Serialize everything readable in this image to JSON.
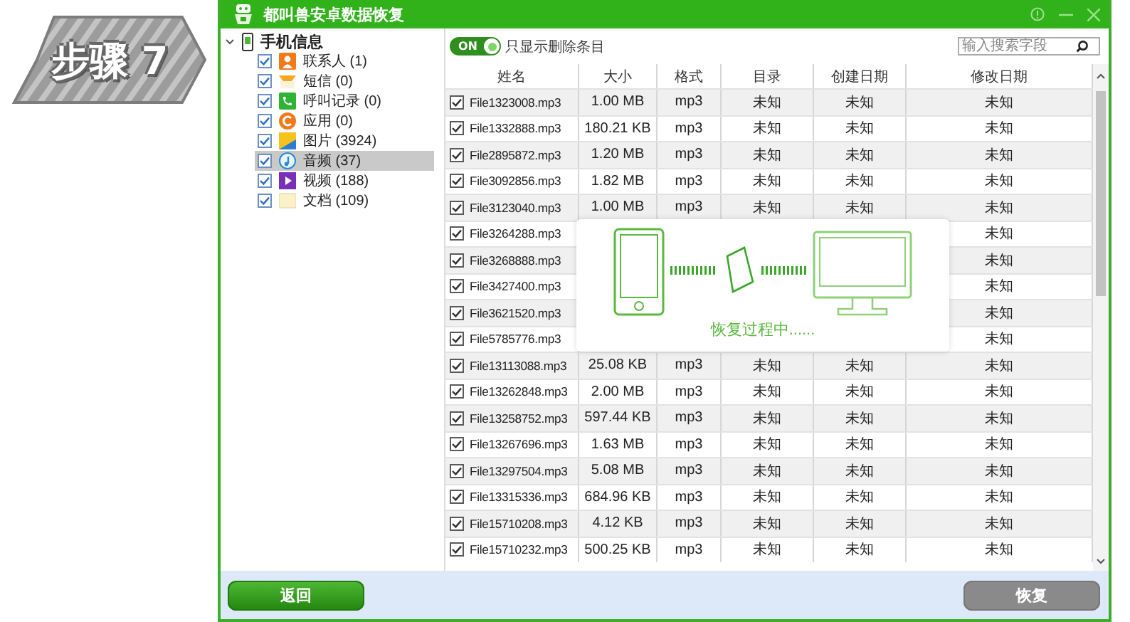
{
  "banner": {
    "text": "步骤 7"
  },
  "window": {
    "title": "都叫兽安卓数据恢复"
  },
  "tree": {
    "label": "手机信息",
    "expanded": true,
    "children": [
      {
        "label": "联系人 (1)",
        "kind": "contacts",
        "checked": true,
        "selected": false
      },
      {
        "label": "短信 (0)",
        "kind": "messages",
        "checked": true,
        "selected": false
      },
      {
        "label": "呼叫记录 (0)",
        "kind": "calls",
        "checked": true,
        "selected": false
      },
      {
        "label": "应用 (0)",
        "kind": "apps",
        "checked": true,
        "selected": false
      },
      {
        "label": "图片 (3924)",
        "kind": "photos",
        "checked": true,
        "selected": false
      },
      {
        "label": "音频 (37)",
        "kind": "audio",
        "checked": true,
        "selected": true
      },
      {
        "label": "视频 (188)",
        "kind": "video",
        "checked": true,
        "selected": false
      },
      {
        "label": "文档 (109)",
        "kind": "documents",
        "checked": true,
        "selected": false
      }
    ]
  },
  "filter": {
    "toggle_text": "ON",
    "on": true,
    "label": "只显示删除条目"
  },
  "search": {
    "placeholder": "输入搜索字段"
  },
  "table": {
    "columns": [
      "姓名",
      "大小",
      "格式",
      "目录",
      "创建日期",
      "修改日期"
    ],
    "rows": [
      {
        "checked": true,
        "name": "File1323008.mp3",
        "size": "1.00 MB",
        "format": "mp3",
        "directory": "未知",
        "created": "未知",
        "modified": "未知"
      },
      {
        "checked": true,
        "name": "File1332888.mp3",
        "size": "180.21 KB",
        "format": "mp3",
        "directory": "未知",
        "created": "未知",
        "modified": "未知"
      },
      {
        "checked": true,
        "name": "File2895872.mp3",
        "size": "1.20 MB",
        "format": "mp3",
        "directory": "未知",
        "created": "未知",
        "modified": "未知"
      },
      {
        "checked": true,
        "name": "File3092856.mp3",
        "size": "1.82 MB",
        "format": "mp3",
        "directory": "未知",
        "created": "未知",
        "modified": "未知"
      },
      {
        "checked": true,
        "name": "File3123040.mp3",
        "size": "1.00 MB",
        "format": "mp3",
        "directory": "未知",
        "created": "未知",
        "modified": "未知"
      },
      {
        "checked": true,
        "name": "File3264288.mp3",
        "modified": "未知"
      },
      {
        "checked": true,
        "name": "File3268888.mp3",
        "modified": "未知"
      },
      {
        "checked": true,
        "name": "File3427400.mp3",
        "modified": "未知"
      },
      {
        "checked": true,
        "name": "File3621520.mp3",
        "modified": "未知"
      },
      {
        "checked": true,
        "name": "File5785776.mp3",
        "modified": "未知"
      },
      {
        "checked": true,
        "name": "File13113088.mp3",
        "size": "25.08 KB",
        "format": "mp3",
        "directory": "未知",
        "created": "未知",
        "modified": "未知"
      },
      {
        "checked": true,
        "name": "File13262848.mp3",
        "size": "2.00 MB",
        "format": "mp3",
        "directory": "未知",
        "created": "未知",
        "modified": "未知"
      },
      {
        "checked": true,
        "name": "File13258752.mp3",
        "size": "597.44 KB",
        "format": "mp3",
        "directory": "未知",
        "created": "未知",
        "modified": "未知"
      },
      {
        "checked": true,
        "name": "File13267696.mp3",
        "size": "1.63 MB",
        "format": "mp3",
        "directory": "未知",
        "created": "未知",
        "modified": "未知"
      },
      {
        "checked": true,
        "name": "File13297504.mp3",
        "size": "5.08 MB",
        "format": "mp3",
        "directory": "未知",
        "created": "未知",
        "modified": "未知"
      },
      {
        "checked": true,
        "name": "File13315336.mp3",
        "size": "684.96 KB",
        "format": "mp3",
        "directory": "未知",
        "created": "未知",
        "modified": "未知"
      },
      {
        "checked": true,
        "name": "File15710208.mp3",
        "size": "4.12 KB",
        "format": "mp3",
        "directory": "未知",
        "created": "未知",
        "modified": "未知"
      },
      {
        "checked": true,
        "name": "File15710232.mp3",
        "size": "500.25 KB",
        "format": "mp3",
        "directory": "未知",
        "created": "未知",
        "modified": "未知"
      }
    ]
  },
  "progress": {
    "message": "恢复过程中......"
  },
  "buttons": {
    "back": {
      "label": "返回"
    },
    "recover": {
      "label": "恢复",
      "disabled": true
    }
  }
}
